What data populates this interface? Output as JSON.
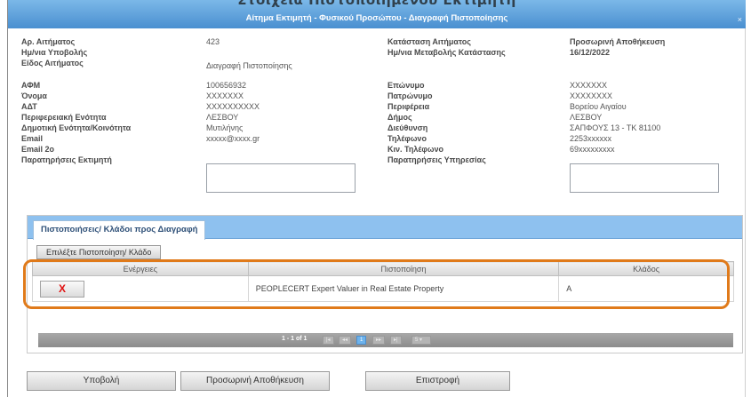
{
  "dialog": {
    "ghost_title": "Στοιχεία Πιστοποιημένου Εκτιμητή",
    "title": "Αίτημα Εκτιμητή - Φυσικού Προσώπου - Διαγραφή Πιστοποίησης",
    "close": "×"
  },
  "request": {
    "number_label": "Αρ. Αιτήματος",
    "number_value": "423",
    "submit_date_label": "Ημ/νια Υποβολής",
    "submit_date_value": "",
    "type_label": "Είδος Αιτήματος",
    "type_value": "Διαγραφή Πιστοποίησης",
    "status_label": "Κατάσταση Αιτήματος",
    "status_value": "Προσωρινή Αποθήκευση",
    "status_date_label": "Ημ/νια Μεταβολής Κατάστασης",
    "status_date_value": "16/12/2022"
  },
  "person": {
    "afm_label": "ΑΦΜ",
    "afm_value": "100656932",
    "name_label": "Όνομα",
    "name_value": "XXXXXXX",
    "adt_label": "ΑΔΤ",
    "adt_value": "XXXXXXXXXX",
    "region_unit_label": "Περιφερειακή Ενότητα",
    "region_unit_value": "ΛΕΣΒΟΥ",
    "municipal_unit_label": "Δημοτική Ενότητα/Κοινότητα",
    "municipal_unit_value": "Μυτιλήνης",
    "email_label": "Email",
    "email_value": "xxxxx@xxxx.gr",
    "email2_label": "Email 2o",
    "email2_value": "",
    "notes_label": "Παρατηρήσεις Εκτιμητή",
    "surname_label": "Επώνυμο",
    "surname_value": "XXXXXXX",
    "father_label": "Πατρώνυμο",
    "father_value": "XXXXXXXX",
    "region_label": "Περιφέρεια",
    "region_value": "Βορείου Αιγαίου",
    "municipality_label": "Δήμος",
    "municipality_value": "ΛΕΣΒΟΥ",
    "address_label": "Διεύθυνση",
    "address_value": "ΣΑΠΦΟΥΣ 13 - ΤΚ 81100",
    "phone_label": "Τηλέφωνο",
    "phone_value": "2253xxxxxx",
    "mobile_label": "Κιν. Τηλέφωνο",
    "mobile_value": "69xxxxxxxxx",
    "service_notes_label": "Παρατηρήσεις Υπηρεσίας"
  },
  "panel": {
    "tab": "Πιστοποιήσεις/ Κλάδοι προς Διαγραφή",
    "select_button": "Επιλέξτε Πιστοποίηση/ Κλάδο",
    "columns": [
      "Ενέργειες",
      "Πιστοποίηση",
      "Κλάδος"
    ],
    "rows": [
      {
        "action": "X",
        "certification": "PEOPLECERT Expert Valuer in Real Estate Property",
        "branch": "A"
      }
    ],
    "pager": {
      "info": "1 - 1 of 1",
      "first": "|◂",
      "prev": "◂◂",
      "page": "1",
      "next": "▸▸",
      "last": "▸|",
      "page_size": "5"
    }
  },
  "actions": {
    "submit": "Υποβολή",
    "save_draft": "Προσωρινή Αποθήκευση",
    "back": "Επιστροφή"
  },
  "colors": {
    "titlebar": "#4a8fd0",
    "panel_header": "#8ec1ef",
    "highlight": "#e07a1a",
    "delete_x": "#e01010"
  }
}
